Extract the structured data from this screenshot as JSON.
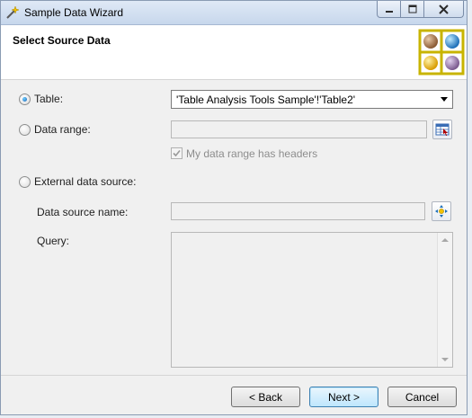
{
  "window": {
    "title": "Sample Data Wizard"
  },
  "header": {
    "title": "Select Source Data"
  },
  "options": {
    "table": {
      "label": "Table:",
      "selected_value": "'Table Analysis Tools Sample'!'Table2'"
    },
    "data_range": {
      "label": "Data range:",
      "headers_checkbox_label": "My data range has headers",
      "headers_checked": true
    },
    "external": {
      "label": "External data source:",
      "data_source_name_label": "Data source name:",
      "query_label": "Query:"
    }
  },
  "buttons": {
    "back": "< Back",
    "next": "Next >",
    "cancel": "Cancel"
  },
  "selected_option": "table",
  "colors": {
    "accent": "#1a5fb4",
    "header_bg": "#ffffff",
    "body_bg": "#f0f0f0"
  }
}
